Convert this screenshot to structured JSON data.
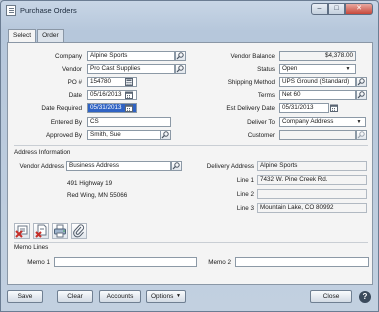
{
  "window": {
    "title": "Purchase Orders",
    "minimize": "–",
    "maximize": "□",
    "close": "✕"
  },
  "tabs": [
    "Select",
    "Order"
  ],
  "header_left": {
    "company_label": "Company",
    "company": "Alpine Sports",
    "vendor_label": "Vendor",
    "vendor": "Pro Cast Supplies",
    "po_label": "PO #",
    "po": "154780",
    "date_label": "Date",
    "date": "05/16/2013",
    "date_required_label": "Date Required",
    "date_required": "05/31/2013",
    "entered_by_label": "Entered By",
    "entered_by": "CS",
    "approved_by_label": "Approved By",
    "approved_by": "Smith, Sue"
  },
  "header_right": {
    "vendor_balance_label": "Vendor Balance",
    "vendor_balance": "$4,378.00",
    "status_label": "Status",
    "status": "Open",
    "shipping_method_label": "Shipping Method",
    "shipping_method": "UPS Ground (Standard)",
    "terms_label": "Terms",
    "terms": "Net 60",
    "est_delivery_label": "Est Delivery Date",
    "est_delivery": "05/31/2013",
    "deliver_to_label": "Deliver To",
    "deliver_to": "Company Address",
    "customer_label": "Customer",
    "customer": ""
  },
  "address": {
    "section_title": "Address Information",
    "vendor_address_label": "Vendor Address",
    "vendor_address_type": "Business Address",
    "vendor_line1": "491 Highway 19",
    "vendor_line2": "Red Wing, MN  55066",
    "delivery_address_label": "Delivery Address",
    "delivery_name": "Alpine Sports",
    "line1_label": "Line 1",
    "line1": "7432 W. Pine Creek Rd.",
    "line2_label": "Line 2",
    "line2": "",
    "line3_label": "Line 3",
    "line3": "Mountain Lake, CO  80992"
  },
  "memo": {
    "section_title": "Memo Lines",
    "memo1_label": "Memo 1",
    "memo1": "",
    "memo2_label": "Memo 2",
    "memo2": ""
  },
  "buttons": {
    "save": "Save",
    "clear": "Clear",
    "accounts": "Accounts",
    "options": "Options",
    "close": "Close",
    "help": "?"
  }
}
